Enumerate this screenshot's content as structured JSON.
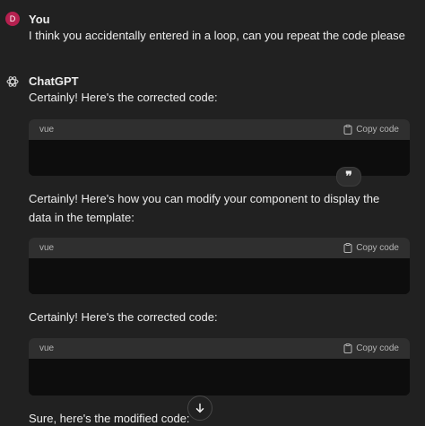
{
  "user_message": {
    "avatar_letter": "D",
    "author": "You",
    "text": "I think you accidentally entered in a loop, can you repeat the code please"
  },
  "assistant": {
    "author": "ChatGPT",
    "icon": "openai-logo-icon",
    "paragraphs": [
      "Certainly! Here's the corrected code:",
      "Certainly! Here's how you can modify your component to display the data in the template:",
      "Certainly! Here's the corrected code:",
      "Sure, here's the modified code:"
    ],
    "code_blocks": [
      {
        "language": "vue",
        "copy_label": "Copy code"
      },
      {
        "language": "vue",
        "copy_label": "Copy code"
      },
      {
        "language": "vue",
        "copy_label": "Copy code"
      }
    ]
  },
  "quote_button": {
    "label": "❞",
    "icon": "quote-icon"
  },
  "scroll_down_button": {
    "icon": "arrow-down-icon"
  },
  "colors": {
    "background": "#212121",
    "code_header": "#2f2f2f",
    "code_body": "#0d0d0d",
    "user_avatar": "#b5204f"
  }
}
